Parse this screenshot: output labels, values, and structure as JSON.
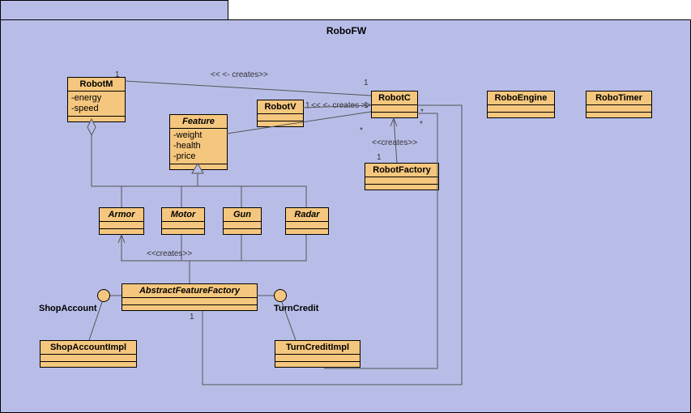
{
  "package": {
    "title": "RoboFW"
  },
  "classes": {
    "RobotM": {
      "name": "RobotM",
      "attrs": [
        "-energy",
        "-speed"
      ]
    },
    "Feature": {
      "name": "Feature",
      "attrs": [
        "-weight",
        "-health",
        "-price"
      ]
    },
    "RobotV": {
      "name": "RobotV"
    },
    "RobotC": {
      "name": "RobotC"
    },
    "RoboEngine": {
      "name": "RoboEngine"
    },
    "RoboTimer": {
      "name": "RoboTimer"
    },
    "RobotFactory": {
      "name": "RobotFactory"
    },
    "Armor": {
      "name": "Armor"
    },
    "Motor": {
      "name": "Motor"
    },
    "Gun": {
      "name": "Gun"
    },
    "Radar": {
      "name": "Radar"
    },
    "AbstractFeatureFactory": {
      "name": "AbstractFeatureFactory"
    },
    "ShopAccountImpl": {
      "name": "ShopAccountImpl"
    },
    "TurnCreditImpl": {
      "name": "TurnCreditImpl"
    }
  },
  "interfaces": {
    "ShopAccount": "ShopAccount",
    "TurnCredit": "TurnCredit"
  },
  "labels": {
    "creates1": "<< <- creates>>",
    "creates2": "<< <- creates >>",
    "creates3": "<<creates>>",
    "creates4": "<<creates>>",
    "m1a": "1",
    "m1b": "1",
    "m1c": "1",
    "m1d": "1",
    "m1e": "1",
    "m1f": "1",
    "mstar1": "*",
    "mstar2": "*",
    "mstar3": "*"
  },
  "chart_data": {
    "type": "uml-class-diagram",
    "package": "RoboFW",
    "classes": [
      {
        "name": "RobotM",
        "abstract": false,
        "attributes": [
          "-energy",
          "-speed"
        ]
      },
      {
        "name": "Feature",
        "abstract": true,
        "attributes": [
          "-weight",
          "-health",
          "-price"
        ]
      },
      {
        "name": "RobotV",
        "abstract": false,
        "attributes": []
      },
      {
        "name": "RobotC",
        "abstract": false,
        "attributes": []
      },
      {
        "name": "RoboEngine",
        "abstract": false,
        "attributes": []
      },
      {
        "name": "RoboTimer",
        "abstract": false,
        "attributes": []
      },
      {
        "name": "RobotFactory",
        "abstract": false,
        "attributes": []
      },
      {
        "name": "Armor",
        "abstract": true,
        "attributes": []
      },
      {
        "name": "Motor",
        "abstract": true,
        "attributes": []
      },
      {
        "name": "Gun",
        "abstract": true,
        "attributes": []
      },
      {
        "name": "Radar",
        "abstract": true,
        "attributes": []
      },
      {
        "name": "AbstractFeatureFactory",
        "abstract": true,
        "attributes": []
      },
      {
        "name": "ShopAccountImpl",
        "abstract": false,
        "attributes": []
      },
      {
        "name": "TurnCreditImpl",
        "abstract": false,
        "attributes": []
      }
    ],
    "interfaces": [
      "ShopAccount",
      "TurnCredit"
    ],
    "relations": [
      {
        "type": "association",
        "from": "RobotM",
        "to": "RobotC",
        "stereotype": "creates",
        "fromMult": "1",
        "toMult": "1"
      },
      {
        "type": "association",
        "from": "RobotV",
        "to": "RobotC",
        "stereotype": "creates",
        "fromMult": "1",
        "toMult": "1"
      },
      {
        "type": "association",
        "from": "RobotFactory",
        "to": "RobotC",
        "stereotype": "creates",
        "fromMult": "1",
        "toMult": "*"
      },
      {
        "type": "aggregation",
        "from": "RobotM",
        "to": "Feature",
        "fromMult": "",
        "toMult": "*"
      },
      {
        "type": "generalization",
        "from": "Armor",
        "to": "Feature"
      },
      {
        "type": "generalization",
        "from": "Motor",
        "to": "Feature"
      },
      {
        "type": "generalization",
        "from": "Gun",
        "to": "Feature"
      },
      {
        "type": "generalization",
        "from": "Radar",
        "to": "Feature"
      },
      {
        "type": "association",
        "from": "AbstractFeatureFactory",
        "to": "Armor",
        "stereotype": "creates",
        "toMult": "*"
      },
      {
        "type": "association",
        "from": "AbstractFeatureFactory",
        "to": "Motor",
        "stereotype": "creates"
      },
      {
        "type": "association",
        "from": "AbstractFeatureFactory",
        "to": "Gun",
        "stereotype": "creates"
      },
      {
        "type": "association",
        "from": "AbstractFeatureFactory",
        "to": "Radar",
        "stereotype": "creates"
      },
      {
        "type": "realization",
        "from": "ShopAccountImpl",
        "to": "ShopAccount"
      },
      {
        "type": "realization",
        "from": "TurnCreditImpl",
        "to": "TurnCredit"
      },
      {
        "type": "dependency",
        "from": "AbstractFeatureFactory",
        "to": "ShopAccount"
      },
      {
        "type": "dependency",
        "from": "AbstractFeatureFactory",
        "to": "TurnCredit"
      },
      {
        "type": "association",
        "from": "AbstractFeatureFactory",
        "to": "RobotC",
        "fromMult": "1",
        "toMult": "*"
      },
      {
        "type": "association",
        "from": "TurnCreditImpl",
        "to": "RobotC"
      }
    ]
  }
}
